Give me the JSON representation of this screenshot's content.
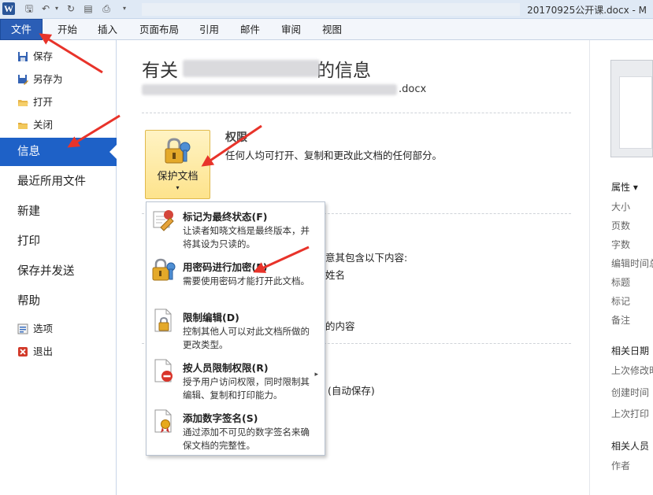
{
  "window": {
    "logo": "W",
    "title": "20170925公开课.docx - M"
  },
  "tabs": [
    {
      "label": "文件"
    },
    {
      "label": "开始"
    },
    {
      "label": "插入"
    },
    {
      "label": "页面布局"
    },
    {
      "label": "引用"
    },
    {
      "label": "邮件"
    },
    {
      "label": "审阅"
    },
    {
      "label": "视图"
    }
  ],
  "nav": {
    "save": "保存",
    "save_as": "另存为",
    "open": "打开",
    "close": "关闭",
    "info": "信息",
    "recent": "最近所用文件",
    "new": "新建",
    "print": "打印",
    "save_send": "保存并发送",
    "help": "帮助",
    "options": "选项",
    "exit": "退出"
  },
  "info": {
    "title_prefix": "有关",
    "title_suffix": "的信息",
    "path_suffix": ".docx",
    "permissions_title": "权限",
    "permissions_desc": "任何人均可打开、复制和更改此文档的任何部分。",
    "protect_button": "保护文档",
    "partial_1": "意其包含以下内容:",
    "partial_2": "姓名",
    "partial_3": "的内容",
    "partial_4": "(自动保存)"
  },
  "protect_menu": [
    {
      "title": "标记为最终状态(F)",
      "desc": "让读者知晓文档是最终版本，并将其设为只读的。"
    },
    {
      "title": "用密码进行加密(E)",
      "desc": "需要使用密码才能打开此文档。"
    },
    {
      "title": "限制编辑(D)",
      "desc": "控制其他人可以对此文档所做的更改类型。"
    },
    {
      "title": "按人员限制权限(R)",
      "desc": "授予用户访问权限，同时限制其编辑、复制和打印能力。"
    },
    {
      "title": "添加数字签名(S)",
      "desc": "通过添加不可见的数字签名来确保文档的完整性。"
    }
  ],
  "properties": {
    "header": "属性 ▾",
    "labels": [
      "大小",
      "页数",
      "字数",
      "编辑时间总",
      "标题",
      "标记",
      "备注"
    ],
    "related_dates": "相关日期",
    "date_labels": [
      "上次修改时",
      "创建时间",
      "上次打印"
    ],
    "related_people": "相关人员",
    "people_labels": [
      "作者"
    ]
  },
  "colors": {
    "file_tab": "#2b5eb6",
    "nav_selected": "#1e61c7",
    "protect_button": "#fde38c",
    "annotation": "#e8332a"
  }
}
